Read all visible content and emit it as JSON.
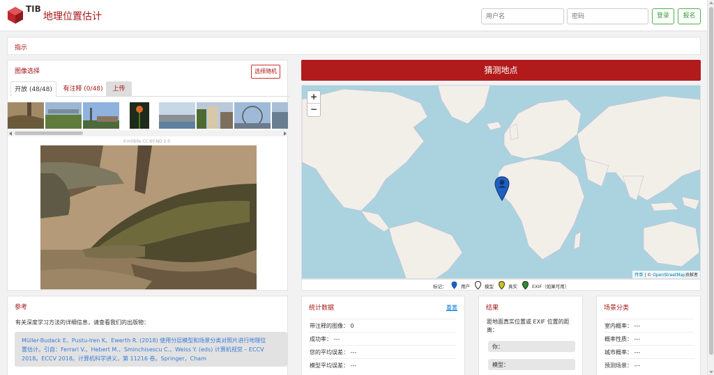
{
  "header": {
    "logo_text": "TIB",
    "title": "地理位置估计",
    "username_placeholder": "用户名",
    "password_placeholder": "密码",
    "login_label": "登录",
    "signup_label": "报名"
  },
  "instructions": {
    "title": "指示"
  },
  "image_selection": {
    "title": "图像选择",
    "random_label": "选择随机",
    "tabs": [
      {
        "label": "开放 (48/48)"
      },
      {
        "label": "有注释 (0/48)"
      },
      {
        "label": "上传"
      }
    ],
    "license": "©m0bile CC-BY-ND 2.0"
  },
  "guess": {
    "label": "猜测地点"
  },
  "map": {
    "zoom_in": "+",
    "zoom_out": "−",
    "attribution_leaflet": "传单",
    "attribution_sep": " | © ",
    "attribution_osm": "OpenStreetMap",
    "attribution_suffix": "贡献者"
  },
  "legend": {
    "prefix": "标记：",
    "items": [
      {
        "label": "用户",
        "color": "#1f5fbf"
      },
      {
        "label": "模型",
        "color": "#222222"
      },
      {
        "label": "真实",
        "color": "#c9c219"
      },
      {
        "label": "EXIF（如果可用）",
        "color": "#2f8f2f"
      }
    ]
  },
  "references": {
    "title": "参考",
    "intro": "有关深度学习方法的详细信息，请查看我们的出版物：",
    "citation_line1": "Müller-Budack E、Pustu-Iren K、Ewerth R. (2018) 使用分层模型和场景分类对照片进行地理位",
    "citation_line2": "置估计。引自：Ferrari V.、Hebert M.、Sminchisescu C.、Weiss Y. (eds) 计算机视觉 – ECCV",
    "citation_line3": "2018。ECCV 2018。计算机科学讲义，第 11216 卷。Springer，Cham"
  },
  "statistics": {
    "title": "统计数据",
    "reset_label": "重置",
    "rows": [
      {
        "label": "带注释的图像：",
        "value": "0"
      },
      {
        "label": "成功率：",
        "value": "---"
      },
      {
        "label": "您的平均误差：",
        "value": "---"
      },
      {
        "label": "模型平均误差：",
        "value": "---"
      }
    ]
  },
  "results": {
    "title": "结果",
    "description": "距地面真实位置或 EXIF 位置的距离：",
    "you_label": "你：",
    "model_label": "模型："
  },
  "scene": {
    "title": "场景分类",
    "rows": [
      {
        "label": "室内概率：",
        "value": "---"
      },
      {
        "label": "概率性质：",
        "value": "---"
      },
      {
        "label": "城市概率：",
        "value": "---"
      },
      {
        "label": "预测场景：",
        "value": "---"
      }
    ]
  },
  "colors": {
    "accent": "#a51717",
    "guess_bg": "#b21b1b",
    "green": "#3c9a3c",
    "sea": "#aad3df",
    "land": "#f2efe9"
  }
}
